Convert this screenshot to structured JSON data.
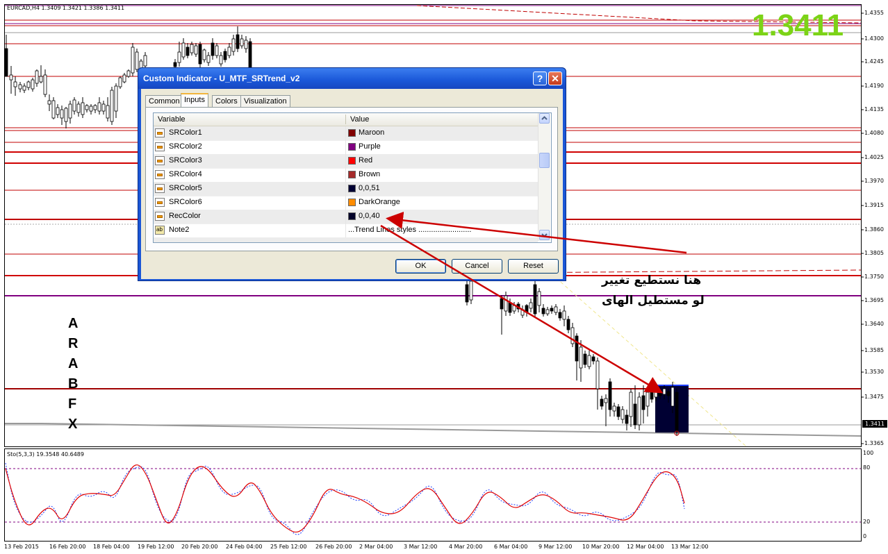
{
  "chart": {
    "symbol_header": "EURCAD,H4  1.3409 1.3421 1.3386 1.3411",
    "big_price": "1.3411",
    "current_price_tag": "1.3411",
    "price_axis": [
      "1.4355",
      "1.4300",
      "1.4245",
      "1.4190",
      "1.4135",
      "1.4080",
      "1.4025",
      "1.3970",
      "1.3915",
      "1.3860",
      "1.3805",
      "1.3750",
      "1.3695",
      "1.3640",
      "1.3585",
      "1.3530",
      "1.3475",
      "1.3365"
    ],
    "time_axis": [
      "13 Feb 2015",
      "16 Feb 20:00",
      "18 Feb 04:00",
      "19 Feb 12:00",
      "20 Feb 20:00",
      "24 Feb 04:00",
      "25 Feb 12:00",
      "26 Feb 20:00",
      "2 Mar 04:00",
      "3 Mar 12:00",
      "4 Mar 20:00",
      "6 Mar 04:00",
      "9 Mar 12:00",
      "10 Mar 20:00",
      "12 Mar 04:00",
      "13 Mar 12:00"
    ],
    "watermark_letters": [
      "A",
      "R",
      "A",
      "B",
      "F",
      "X"
    ],
    "annotation_line1": "هنا نستطيع تغيير",
    "annotation_line2": "لو مستطيل الهاى"
  },
  "stochastic": {
    "header": "Sto(5,3,3) 19.3548 40.6489",
    "levels": [
      "100",
      "80",
      "20",
      "0"
    ]
  },
  "dialog": {
    "title": "Custom Indicator - U_MTF_SRTrend_v2",
    "help_label": "?",
    "close_label": "✕",
    "tabs": [
      "Common",
      "Inputs",
      "Colors",
      "Visualization"
    ],
    "active_tab": "Inputs",
    "columns": {
      "variable": "Variable",
      "value": "Value"
    },
    "rows": [
      {
        "name": "SRColor1",
        "value": "Maroon",
        "color": "#800000"
      },
      {
        "name": "SRColor2",
        "value": "Purple",
        "color": "#800080"
      },
      {
        "name": "SRColor3",
        "value": "Red",
        "color": "#ff0000"
      },
      {
        "name": "SRColor4",
        "value": "Brown",
        "color": "#a52a2a"
      },
      {
        "name": "SRColor5",
        "value": "0,0,51",
        "color": "#000033"
      },
      {
        "name": "SRColor6",
        "value": "DarkOrange",
        "color": "#ff8c00"
      },
      {
        "name": "RecColor",
        "value": "0,0,40",
        "color": "#000028"
      },
      {
        "name": "Note2",
        "value": "...Trend Lines styles .........................",
        "color": ""
      }
    ],
    "buttons": {
      "ok": "OK",
      "cancel": "Cancel",
      "reset": "Reset"
    }
  },
  "colors": {
    "bull_green": "#7cd317",
    "sr_red": "#c00000",
    "rect_navy": "#000033",
    "arrow_red": "#cc0000"
  }
}
